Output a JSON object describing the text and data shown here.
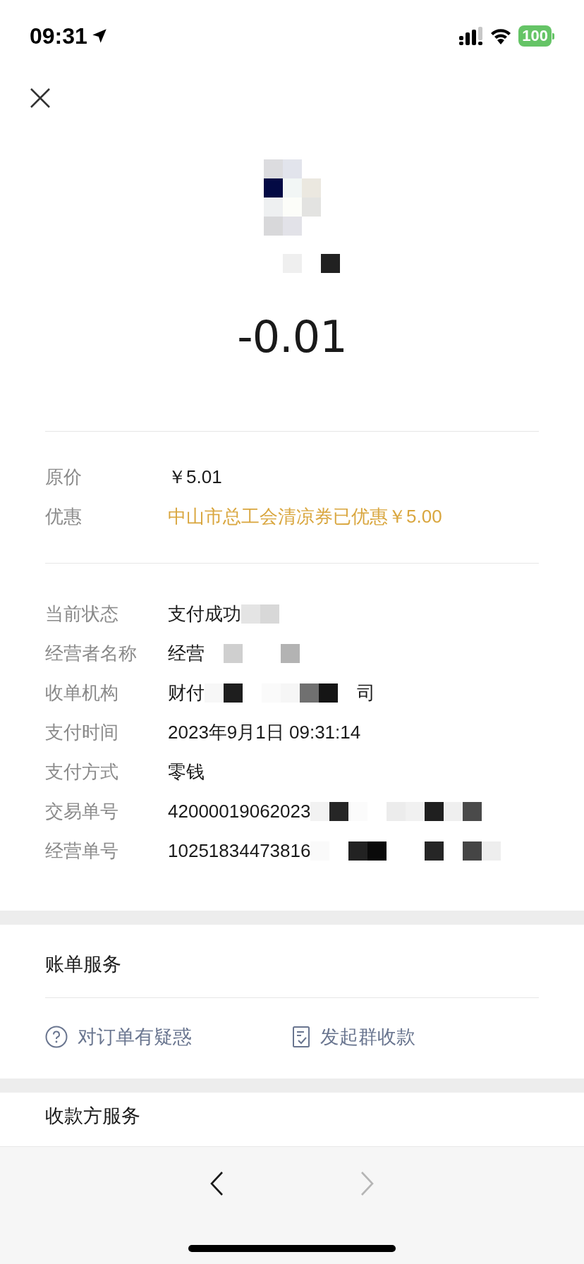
{
  "status_bar": {
    "time": "09:31",
    "battery": "100"
  },
  "amount": "-0.01",
  "price_rows": [
    {
      "label": "原价",
      "value": "￥5.01",
      "kind": "plain"
    },
    {
      "label": "优惠",
      "value": "中山市总工会清凉券已优惠￥5.00",
      "kind": "discount"
    }
  ],
  "detail_rows": [
    {
      "label": "当前状态",
      "value": "支付成功",
      "suffix": ""
    },
    {
      "label": "经营者名称",
      "value": "经营",
      "suffix": ""
    },
    {
      "label": "收单机构",
      "value": "财付",
      "suffix": "司"
    },
    {
      "label": "支付时间",
      "value": "2023年9月1日 09:31:14",
      "suffix": ""
    },
    {
      "label": "支付方式",
      "value": "零钱",
      "suffix": ""
    },
    {
      "label": "交易单号",
      "value": "42000019062023",
      "suffix": ""
    },
    {
      "label": "经营单号",
      "value": "10251834473816",
      "suffix": ""
    }
  ],
  "bill_service": {
    "title": "账单服务",
    "actions": [
      {
        "label": "对订单有疑惑",
        "kind": "question"
      },
      {
        "label": "发起群收款",
        "kind": "receipt"
      }
    ]
  },
  "payee_service": {
    "title": "收款方服务"
  },
  "toolbar": {
    "back_enabled": true,
    "forward_enabled": false
  }
}
